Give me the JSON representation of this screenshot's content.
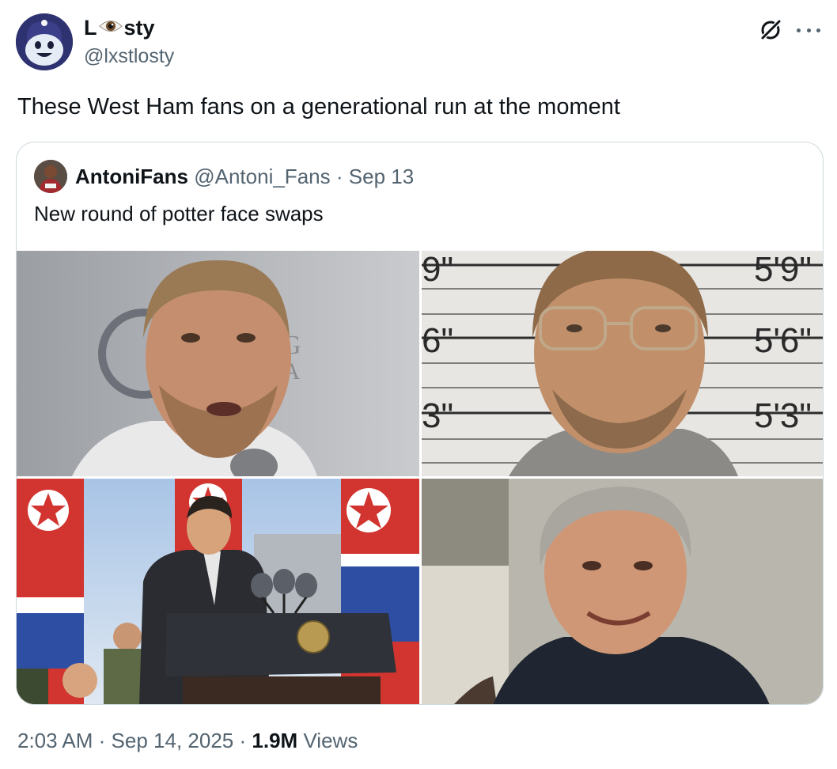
{
  "author": {
    "display_name_start": "L",
    "display_name_end": "sty",
    "handle": "@lxstlosty",
    "avatar_icon": "ghost-mascot-icon"
  },
  "tweet": {
    "text": "These West Ham fans on a generational run at the moment"
  },
  "quoted": {
    "name": "AntoniFans",
    "handle": "@Antoni_Fans",
    "separator": "·",
    "date": "Sep 13",
    "text": "New round of potter face swaps",
    "images": [
      {
        "icon": "press-conference-photo",
        "backdrop_text": "G\nSA"
      },
      {
        "icon": "mugshot-photo",
        "height_marks": [
          "9\"",
          "6\"",
          "3\"",
          "5'9\"",
          "5'6\"",
          "5'3\""
        ]
      },
      {
        "icon": "podium-speech-photo"
      },
      {
        "icon": "portrait-photo"
      }
    ]
  },
  "meta": {
    "time": "2:03 AM",
    "sep": "·",
    "date": "Sep 14, 2025",
    "views_count": "1.9M",
    "views_label": "Views"
  },
  "colors": {
    "text_primary": "#0f1419",
    "text_secondary": "#536471",
    "border": "#cfd9de"
  }
}
